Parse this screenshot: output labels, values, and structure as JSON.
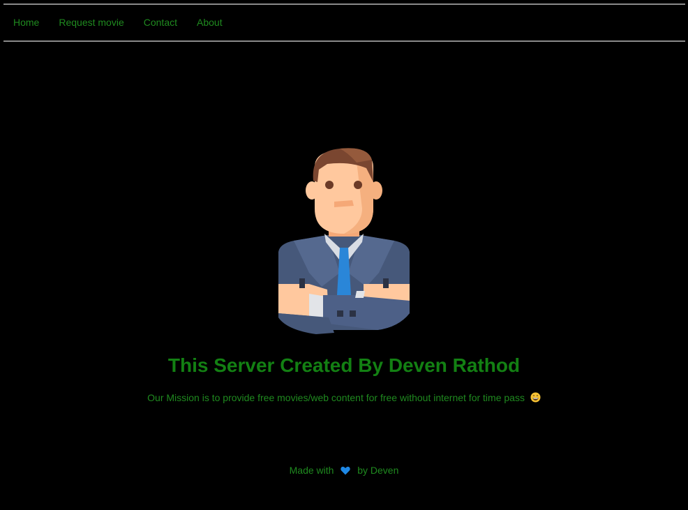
{
  "nav": {
    "items": [
      {
        "label": "Home"
      },
      {
        "label": "Request movie"
      },
      {
        "label": "Contact"
      },
      {
        "label": "About"
      }
    ]
  },
  "main": {
    "avatar_icon": "businessman-avatar-icon",
    "headline": "This Server Created By Deven Rathod",
    "mission": "Our Mission is to provide free movies/web content for free without internet for time pass",
    "mission_emoji_icon": "grinning-face-emoji-icon"
  },
  "footer": {
    "made_with": "Made with",
    "heart_icon": "blue-heart-icon",
    "by_text": "by Deven"
  },
  "colors": {
    "background": "#000000",
    "text_green": "#1f8a1f",
    "headline_green": "#138013",
    "divider": "#8a8a8a",
    "heart_blue": "#1e88e5"
  }
}
